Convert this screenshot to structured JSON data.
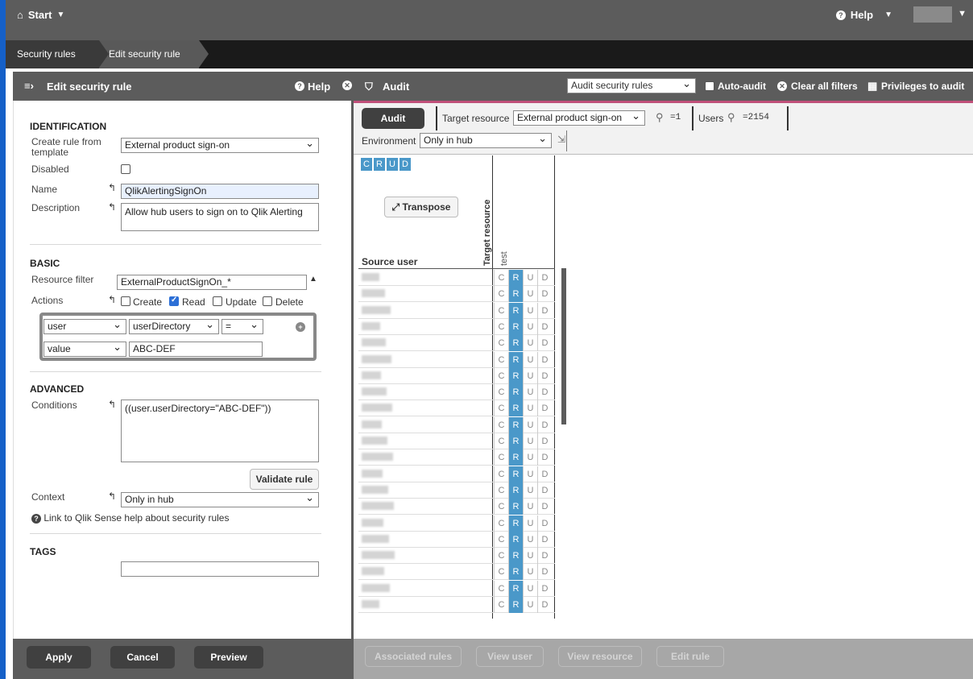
{
  "topbar": {
    "start_label": "Start",
    "help_label": "Help"
  },
  "breadcrumb": [
    "Security rules",
    "Edit security rule"
  ],
  "left_panel": {
    "title": "Edit security rule",
    "help_label": "Help",
    "identification": {
      "title": "IDENTIFICATION",
      "template_label": "Create rule from template",
      "template_value": "External product sign-on",
      "disabled_label": "Disabled",
      "name_label": "Name",
      "name_value": "QlikAlertingSignOn",
      "description_label": "Description",
      "description_value": "Allow hub users to sign on to Qlik Alerting"
    },
    "basic": {
      "title": "BASIC",
      "resource_filter_label": "Resource filter",
      "resource_filter_value": "ExternalProductSignOn_*",
      "actions_label": "Actions",
      "create_label": "Create",
      "read_label": "Read",
      "update_label": "Update",
      "delete_label": "Delete",
      "cond_row1": [
        "user",
        "userDirectory",
        "="
      ],
      "cond_row2_type": "value",
      "cond_row2_value": "ABC-DEF"
    },
    "advanced": {
      "title": "ADVANCED",
      "conditions_label": "Conditions",
      "conditions_value": "((user.userDirectory=\"ABC-DEF\"))",
      "validate_label": "Validate rule",
      "context_label": "Context",
      "context_value": "Only in hub",
      "help_link": "Link to Qlik Sense help about security rules"
    },
    "tags": {
      "title": "TAGS"
    },
    "footer": {
      "apply": "Apply",
      "cancel": "Cancel",
      "preview": "Preview"
    }
  },
  "audit": {
    "title": "Audit",
    "select_value": "Audit security rules",
    "auto_audit": "Auto-audit",
    "clear_filters": "Clear all filters",
    "privileges": "Privileges to audit",
    "audit_button": "Audit",
    "target_resource_label": "Target resource",
    "target_resource_value": "External product sign-on",
    "target_count": "=1",
    "users_label": "Users",
    "users_count": "=2154",
    "environment_label": "Environment",
    "environment_value": "Only in hub",
    "crud": [
      "C",
      "R",
      "U",
      "D"
    ],
    "transpose": "Transpose",
    "target_resource_col": "Target resource",
    "test_col": "test",
    "source_user_col": "Source user",
    "row_count": 21,
    "row_cells": [
      "C",
      "R",
      "U",
      "D"
    ],
    "footer": [
      "Associated rules",
      "View user",
      "View resource",
      "Edit rule"
    ]
  }
}
